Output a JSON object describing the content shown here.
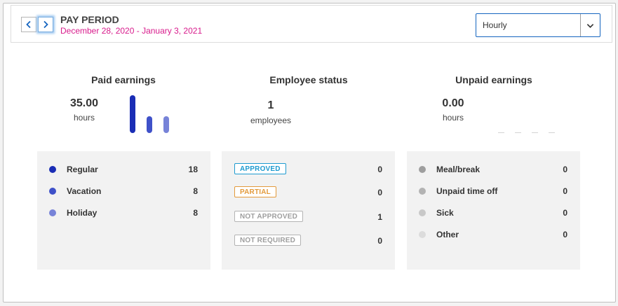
{
  "header": {
    "title": "PAY PERIOD",
    "dates": "December 28, 2020 - January 3, 2021",
    "select_value": "Hourly"
  },
  "paid": {
    "title": "Paid earnings",
    "total": "35.00",
    "unit": "hours",
    "items": [
      {
        "label": "Regular",
        "value": "18",
        "color": "#1a2db5"
      },
      {
        "label": "Vacation",
        "value": "8",
        "color": "#3f51c9"
      },
      {
        "label": "Holiday",
        "value": "8",
        "color": "#7783d8"
      }
    ]
  },
  "status": {
    "title": "Employee status",
    "total": "1",
    "unit": "employees",
    "items": [
      {
        "label": "APPROVED",
        "value": "0",
        "color": "#1e9bd0"
      },
      {
        "label": "PARTIAL",
        "value": "0",
        "color": "#e39a3b"
      },
      {
        "label": "NOT APPROVED",
        "value": "1",
        "color": "#b3b3b3"
      },
      {
        "label": "NOT REQUIRED",
        "value": "0",
        "color": "#b3b3b3"
      }
    ]
  },
  "unpaid": {
    "title": "Unpaid earnings",
    "total": "0.00",
    "unit": "hours",
    "items": [
      {
        "label": "Meal/break",
        "value": "0",
        "color": "#9e9e9e"
      },
      {
        "label": "Unpaid time off",
        "value": "0",
        "color": "#b3b3b3"
      },
      {
        "label": "Sick",
        "value": "0",
        "color": "#c8c8c8"
      },
      {
        "label": "Other",
        "value": "0",
        "color": "#dcdcdc"
      }
    ]
  }
}
